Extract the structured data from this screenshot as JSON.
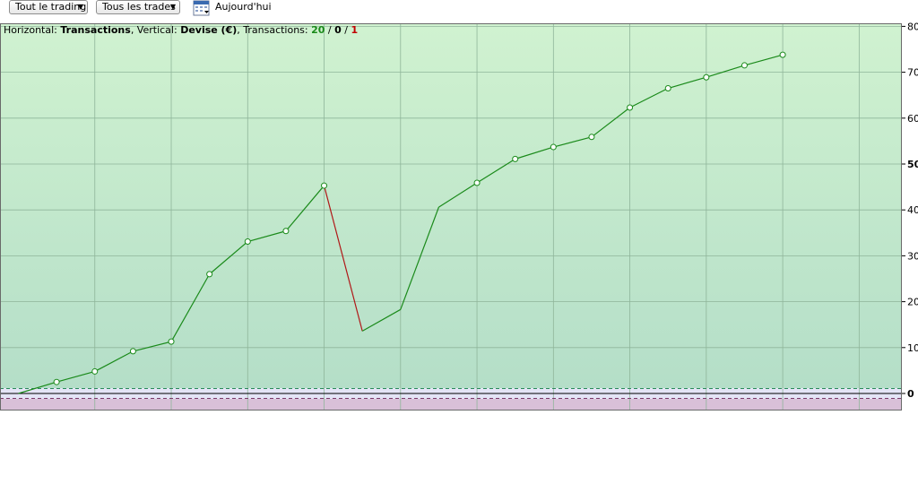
{
  "toolbar": {
    "dropdown_trading": "Tout le trading",
    "dropdown_trades": "Tous les trades",
    "today_label": "Aujourd'hui",
    "calendar_icon": "calendar-icon"
  },
  "header": {
    "h_prefix": "Horizontal: ",
    "h_value": "Transactions",
    "v_prefix": ", Vertical: ",
    "v_value": "Devise (€)",
    "t_prefix": ", Transactions: ",
    "wins": "20",
    "sep1": " / ",
    "neutral": "0",
    "sep2": " / ",
    "losses": "1"
  },
  "colors": {
    "bg_top": "#d0f2d0",
    "bg_bottom": "#b4dec8",
    "win_line": "#1a8a1a",
    "loss_line": "#b01818",
    "negative_zone": "#d9c0d8",
    "zero_band": "#e4e4f6"
  },
  "chart_data": {
    "type": "line",
    "xlabel": "Transactions",
    "ylabel": "Devise (€)",
    "ylim": [
      -4,
      81
    ],
    "y_ticks": [
      "0",
      "10",
      "20",
      "30",
      "40",
      "50",
      "60",
      "70",
      "80"
    ],
    "grid": true,
    "x": [
      0,
      1,
      2,
      3,
      4,
      5,
      6,
      7,
      8,
      9,
      10,
      11,
      12,
      13,
      14,
      15,
      16,
      17,
      18,
      19,
      20,
      21
    ],
    "values": [
      0,
      2.5,
      4.8,
      9.2,
      11.3,
      26.0,
      33.1,
      35.4,
      45.3,
      13.6,
      18.3,
      40.6,
      45.9,
      51.1,
      53.7,
      55.9,
      62.3,
      66.5,
      68.9,
      71.5,
      73.8
    ],
    "markers": [
      false,
      true,
      true,
      true,
      true,
      true,
      true,
      true,
      true,
      false,
      false,
      false,
      true,
      true,
      true,
      true,
      true,
      true,
      true,
      true,
      true
    ]
  }
}
